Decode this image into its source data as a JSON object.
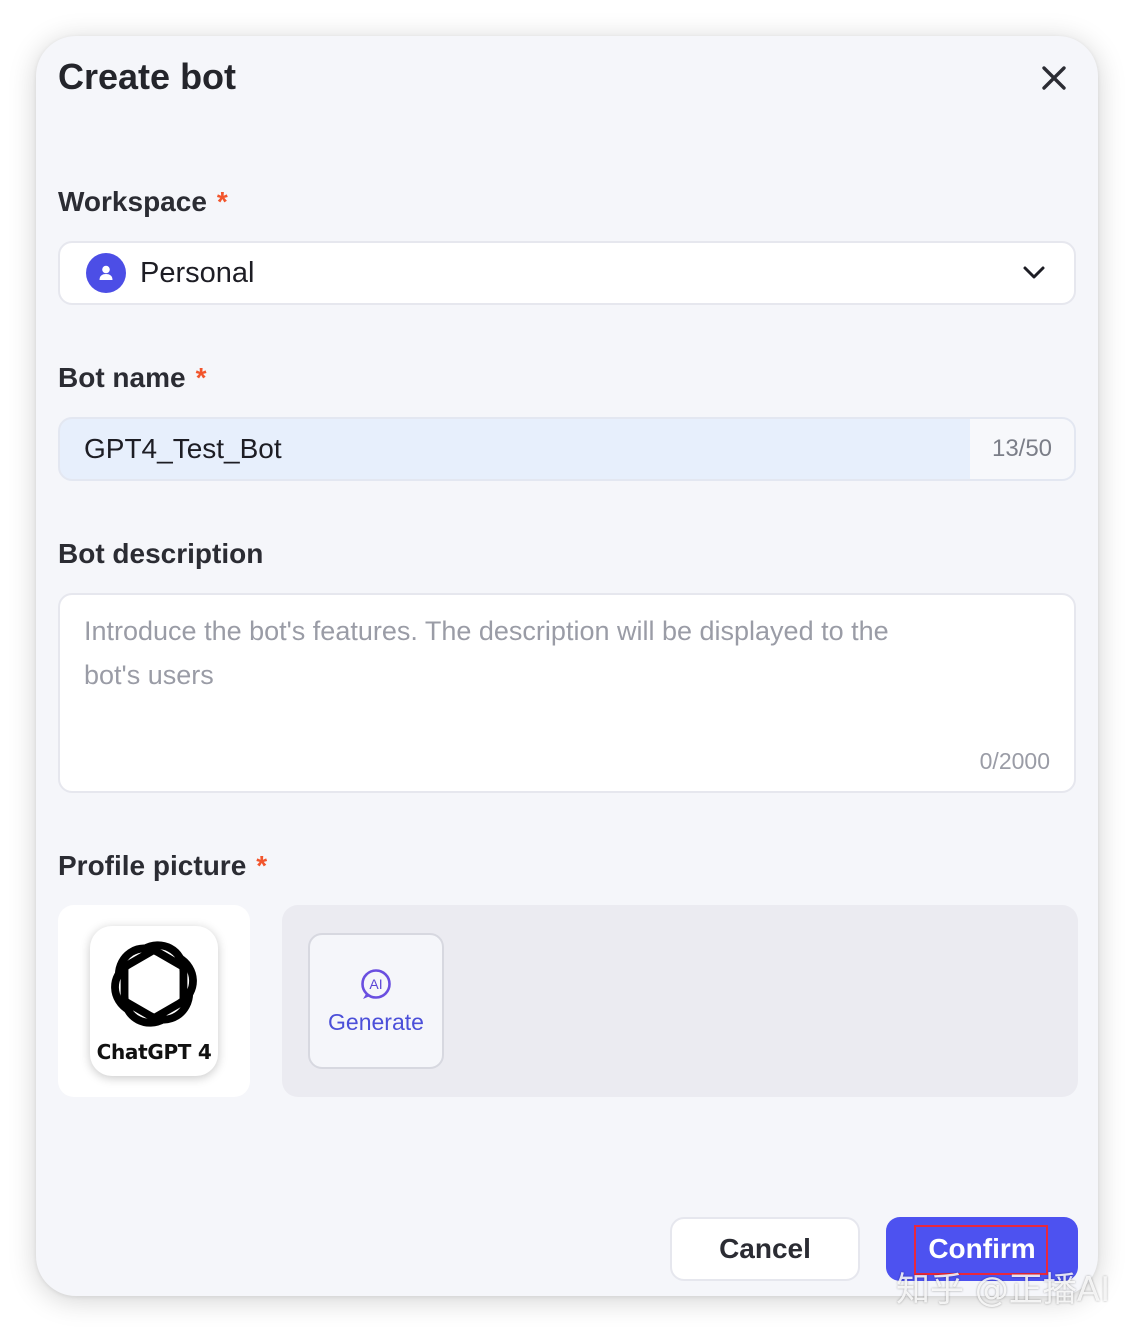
{
  "dialog": {
    "title": "Create bot",
    "close_icon": "close-icon"
  },
  "workspace": {
    "label": "Workspace",
    "required_mark": "*",
    "selected": "Personal",
    "icon": "person-icon",
    "dropdown_icon": "chevron-down-icon"
  },
  "bot_name": {
    "label": "Bot name",
    "required_mark": "*",
    "value": "GPT4_Test_Bot",
    "counter": "13/50"
  },
  "bot_description": {
    "label": "Bot description",
    "placeholder": "Introduce the bot's features. The description will be displayed to the bot's users",
    "counter": "0/2000"
  },
  "profile_picture": {
    "label": "Profile picture",
    "required_mark": "*",
    "image_caption": "ChatGPT 4",
    "generate_label": "Generate",
    "generate_icon": "ai-icon"
  },
  "footer": {
    "cancel_label": "Cancel",
    "confirm_label": "Confirm"
  },
  "watermark": "知乎 @正播AI",
  "colors": {
    "accent": "#4d52f0",
    "required": "#f2552c",
    "highlight_box": "#e8283c"
  }
}
